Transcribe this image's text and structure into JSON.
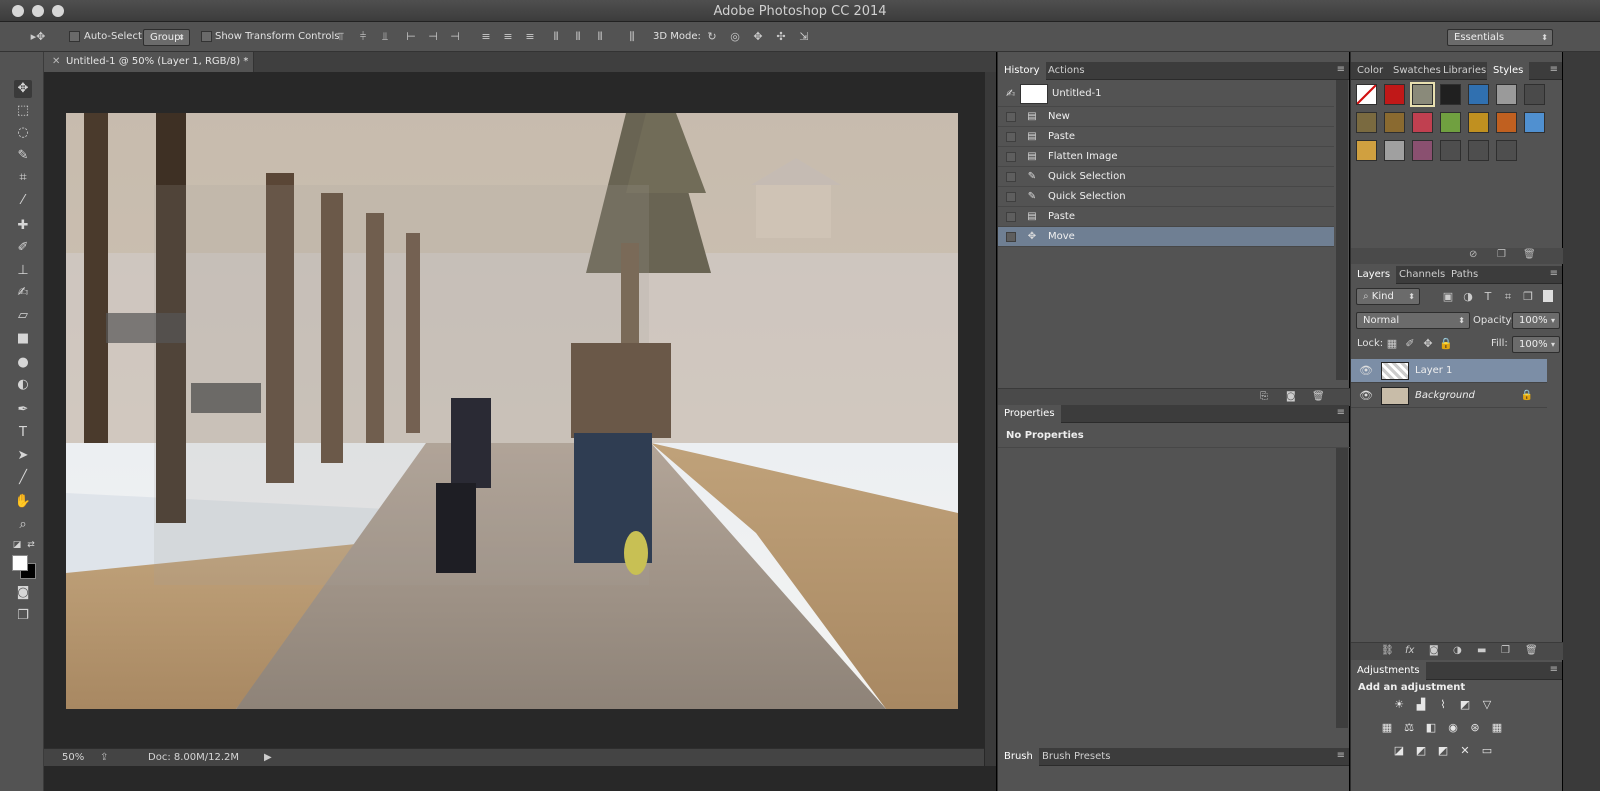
{
  "window": {
    "title": "Adobe Photoshop CC 2014"
  },
  "options": {
    "auto_select_label": "Auto-Select:",
    "auto_select_value": "Group",
    "show_transform_label": "Show Transform Controls",
    "mode_3d_label": "3D Mode:",
    "workspace_value": "Essentials"
  },
  "document": {
    "tab_title": "Untitled-1 @ 50% (Layer 1, RGB/8) *",
    "zoom": "50%",
    "doc_info": "Doc: 8.00M/12.2M"
  },
  "history": {
    "tabs": [
      "History",
      "Actions"
    ],
    "snapshot": "Untitled-1",
    "items": [
      {
        "label": "New",
        "icon": "document-icon"
      },
      {
        "label": "Paste",
        "icon": "document-icon"
      },
      {
        "label": "Flatten Image",
        "icon": "document-icon"
      },
      {
        "label": "Quick Selection",
        "icon": "quick-selection-icon"
      },
      {
        "label": "Quick Selection",
        "icon": "quick-selection-icon"
      },
      {
        "label": "Paste",
        "icon": "document-icon"
      },
      {
        "label": "Move",
        "icon": "move-icon"
      }
    ],
    "selected_index": 6
  },
  "properties": {
    "tab": "Properties",
    "content": "No Properties"
  },
  "brush": {
    "tabs": [
      "Brush",
      "Brush Presets"
    ]
  },
  "styles": {
    "tabs": [
      "Color",
      "Swatches",
      "Libraries",
      "Styles"
    ],
    "active_tab": "Styles",
    "swatches": [
      "#ffffff",
      "#c01818",
      "#8a8a7a",
      "#202020",
      "#3070b0",
      "#9a9a9a",
      "#4a4a4a",
      "#7a6a40",
      "#8a6a30",
      "#c04050",
      "#70a040",
      "#c09020",
      "#c06020",
      "#5090d0",
      "#d0a040",
      "#a0a0a0",
      "#8a5070",
      "#4e4e4e",
      "#4e4e4e",
      "#4e4e4e"
    ]
  },
  "layers": {
    "tabs": [
      "Layers",
      "Channels",
      "Paths"
    ],
    "filter": "Kind",
    "blend_mode": "Normal",
    "opacity_label": "Opacity:",
    "opacity": "100%",
    "lock_label": "Lock:",
    "fill_label": "Fill:",
    "fill": "100%",
    "items": [
      {
        "name": "Layer 1",
        "selected": true
      },
      {
        "name": "Background",
        "selected": false
      }
    ]
  },
  "adjustments": {
    "tab": "Adjustments",
    "heading": "Add an adjustment"
  }
}
